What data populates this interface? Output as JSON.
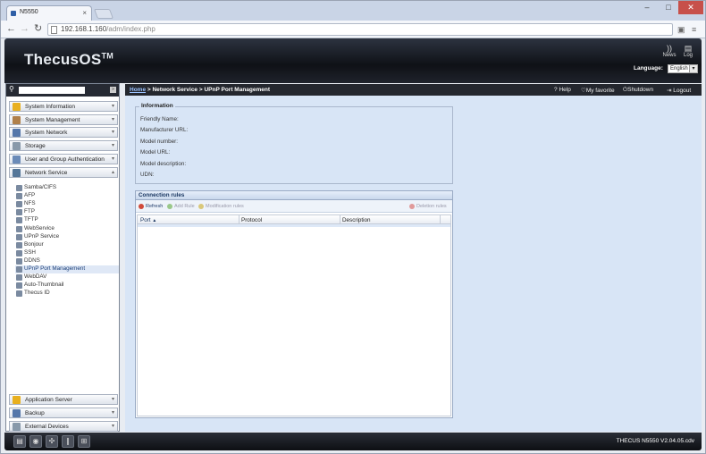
{
  "browser": {
    "tab_title": "N5550",
    "tab_close": "×",
    "url_host": "192.168.1.160",
    "url_path": "/adm/index.php",
    "window_controls": [
      "–",
      "□",
      "✕"
    ]
  },
  "header": {
    "logo": "ThecusOS",
    "logo_tm": "TM",
    "news_label": "News",
    "log_label": "Log",
    "language_label": "Language:",
    "language_value": "English"
  },
  "sidebar": {
    "groups": [
      {
        "label": "System Information",
        "color": "#e8b020"
      },
      {
        "label": "System Management",
        "color": "#b0804a"
      },
      {
        "label": "System Network",
        "color": "#5577aa"
      },
      {
        "label": "Storage",
        "color": "#8899aa"
      },
      {
        "label": "User and Group Authentication",
        "color": "#6b8bb8"
      },
      {
        "label": "Network Service",
        "color": "#557799"
      }
    ],
    "network_service_items": [
      "Samba/CIFS",
      "AFP",
      "NFS",
      "FTP",
      "TFTP",
      "WebService",
      "UPnP Service",
      "Bonjour",
      "SSH",
      "DDNS",
      "UPnP Port Management",
      "WebDAV",
      "Auto-Thumbnail",
      "Thecus ID"
    ],
    "selected_item": "UPnP Port Management",
    "bottom_groups": [
      {
        "label": "Application Server",
        "color": "#e8b020"
      },
      {
        "label": "Backup",
        "color": "#5577aa"
      },
      {
        "label": "External Devices",
        "color": "#8899aa"
      }
    ]
  },
  "breadcrumb": {
    "home": "Home",
    "rest": " > Network Service > UPnP Port Management"
  },
  "toplinks": {
    "help": "Help",
    "favorite": "My favorite",
    "shutdown": "Shutdown",
    "logout": "Logout"
  },
  "information": {
    "legend": "Information",
    "fields": [
      "Friendly Name:",
      "Manufacturer URL:",
      "Model number:",
      "Model URL:",
      "Model description:",
      "UDN:"
    ]
  },
  "rules": {
    "title": "Connection rules",
    "toolbar": {
      "refresh": "Refresh",
      "add": "Add Rule",
      "modify": "Modification rules",
      "delete": "Deletion rules"
    },
    "columns": [
      "Port",
      "Protocol",
      "Description"
    ],
    "sort_indicator": "▲"
  },
  "footer": {
    "version": "THECUS N5550 V2.04.05.cdv"
  }
}
